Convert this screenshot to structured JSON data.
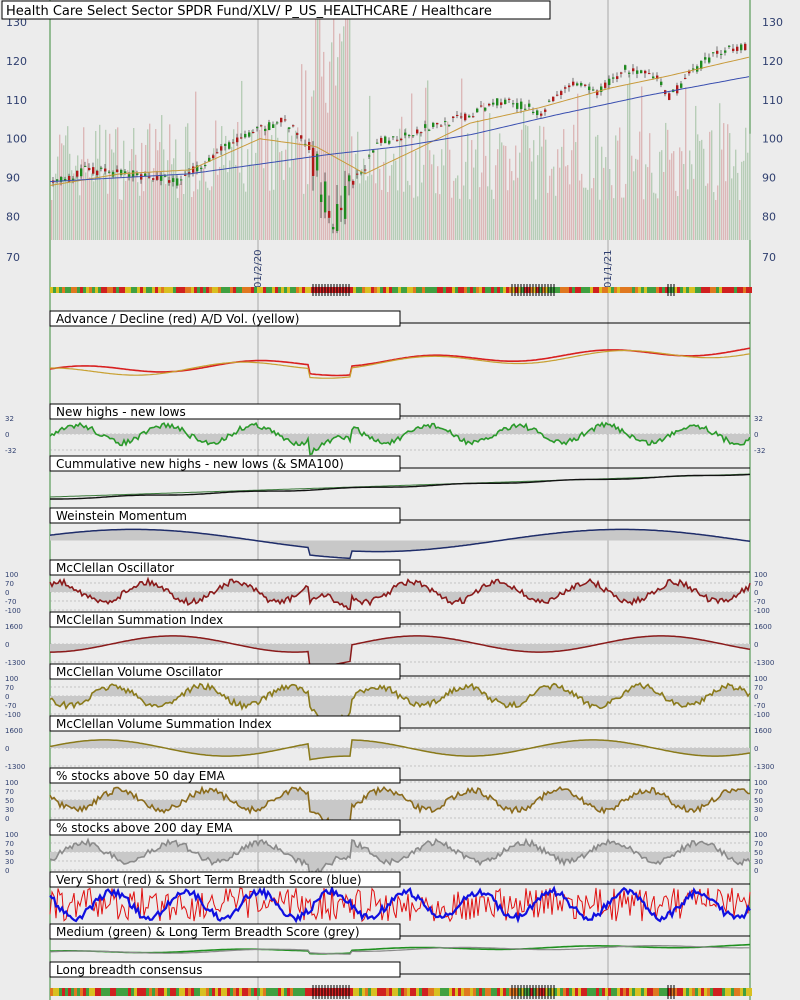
{
  "chart_data": {
    "title": "Health Care Select Sector SPDR Fund/XLV/ P_US_HEALTHCARE / Healthcare",
    "date_labels": [
      "01/2/20",
      "01/1/21"
    ],
    "colors": {
      "background": "#ececec",
      "up_candle": "#1f8a1f",
      "down_candle": "#b01818",
      "ema_short": "#c89a3a",
      "sma_long": "#3a4fb0",
      "breadth_bar": [
        "#d02020",
        "#e07820",
        "#d8c020",
        "#40a040"
      ]
    },
    "price_panel": {
      "type": "candlestick",
      "y_ticks": [
        130,
        120,
        110,
        100,
        90,
        80,
        70
      ],
      "ylim": [
        70,
        133
      ],
      "approx_path": [
        {
          "x": 0,
          "y": 88
        },
        {
          "x": 0.05,
          "y": 92
        },
        {
          "x": 0.12,
          "y": 91
        },
        {
          "x": 0.18,
          "y": 89
        },
        {
          "x": 0.25,
          "y": 98
        },
        {
          "x": 0.33,
          "y": 105
        },
        {
          "x": 0.37,
          "y": 98
        },
        {
          "x": 0.405,
          "y": 77
        },
        {
          "x": 0.43,
          "y": 88
        },
        {
          "x": 0.47,
          "y": 99
        },
        {
          "x": 0.52,
          "y": 102
        },
        {
          "x": 0.6,
          "y": 106
        },
        {
          "x": 0.64,
          "y": 110
        },
        {
          "x": 0.7,
          "y": 107
        },
        {
          "x": 0.74,
          "y": 114
        },
        {
          "x": 0.78,
          "y": 112
        },
        {
          "x": 0.82,
          "y": 118
        },
        {
          "x": 0.87,
          "y": 115
        },
        {
          "x": 0.88,
          "y": 110
        },
        {
          "x": 0.92,
          "y": 118
        },
        {
          "x": 0.96,
          "y": 123
        },
        {
          "x": 1,
          "y": 124
        }
      ],
      "ema_path": [
        {
          "x": 0,
          "y": 88
        },
        {
          "x": 0.1,
          "y": 91
        },
        {
          "x": 0.2,
          "y": 92
        },
        {
          "x": 0.3,
          "y": 100
        },
        {
          "x": 0.38,
          "y": 98
        },
        {
          "x": 0.45,
          "y": 91
        },
        {
          "x": 0.52,
          "y": 97
        },
        {
          "x": 0.6,
          "y": 104
        },
        {
          "x": 0.7,
          "y": 108
        },
        {
          "x": 0.8,
          "y": 113
        },
        {
          "x": 0.88,
          "y": 116
        },
        {
          "x": 1,
          "y": 121
        }
      ],
      "sma_path": [
        {
          "x": 0,
          "y": 89
        },
        {
          "x": 0.2,
          "y": 91
        },
        {
          "x": 0.4,
          "y": 96
        },
        {
          "x": 0.5,
          "y": 98
        },
        {
          "x": 0.6,
          "y": 101
        },
        {
          "x": 0.72,
          "y": 106
        },
        {
          "x": 0.85,
          "y": 111
        },
        {
          "x": 1,
          "y": 116
        }
      ]
    },
    "panels": [
      {
        "title": "Advance / Decline (red) A/D Vol. (yellow)",
        "kind": "line2",
        "colors": [
          "#d82020",
          "#c8a030"
        ],
        "ticks": []
      },
      {
        "title": "New highs - new lows",
        "kind": "osc",
        "colors": [
          "#2a9a2a"
        ],
        "ticks": [
          "32",
          "0",
          "-32"
        ]
      },
      {
        "title": "Cummulative new highs - new lows (& SMA100)",
        "kind": "cum",
        "colors": [
          "#111111",
          "#3a7a3a"
        ],
        "ticks": []
      },
      {
        "title": "Weinstein Momentum",
        "kind": "area",
        "colors": [
          "#1f2d6a"
        ],
        "ticks": []
      },
      {
        "title": "McClellan Oscillator",
        "kind": "osc",
        "colors": [
          "#8a1a1a"
        ],
        "ticks": [
          "100",
          "70",
          "0",
          "-70",
          "-100"
        ]
      },
      {
        "title": "McClellan Summation Index",
        "kind": "smooth",
        "colors": [
          "#8a1a1a"
        ],
        "ticks": [
          "1600",
          "0",
          "-1300"
        ]
      },
      {
        "title": "McClellan Volume Oscillator",
        "kind": "osc",
        "colors": [
          "#8a7a1a"
        ],
        "ticks": [
          "100",
          "70",
          "0",
          "-70",
          "-100"
        ]
      },
      {
        "title": "McClellan Volume Summation Index",
        "kind": "smooth",
        "colors": [
          "#8a7a1a"
        ],
        "ticks": [
          "1600",
          "0",
          "-1300"
        ]
      },
      {
        "title": "% stocks above 50 day EMA",
        "kind": "pct",
        "colors": [
          "#8a6a1a"
        ],
        "ticks": [
          "100",
          "70",
          "50",
          "30",
          "0"
        ]
      },
      {
        "title": "% stocks above 200 day EMA",
        "kind": "pct",
        "colors": [
          "#8a8a8a"
        ],
        "ticks": [
          "100",
          "70",
          "50",
          "30",
          "0"
        ]
      },
      {
        "title": "Very Short (red) & Short Term Breadth Score (blue)",
        "kind": "noisy2",
        "colors": [
          "#e01010",
          "#1010e0"
        ],
        "ticks": []
      },
      {
        "title": "Medium (green) & Long Term Breadth Score (grey)",
        "kind": "line2",
        "colors": [
          "#209020",
          "#8a8a8a"
        ],
        "ticks": []
      },
      {
        "title": "Long breadth consensus",
        "kind": "bar",
        "colors": [],
        "ticks": []
      }
    ]
  }
}
